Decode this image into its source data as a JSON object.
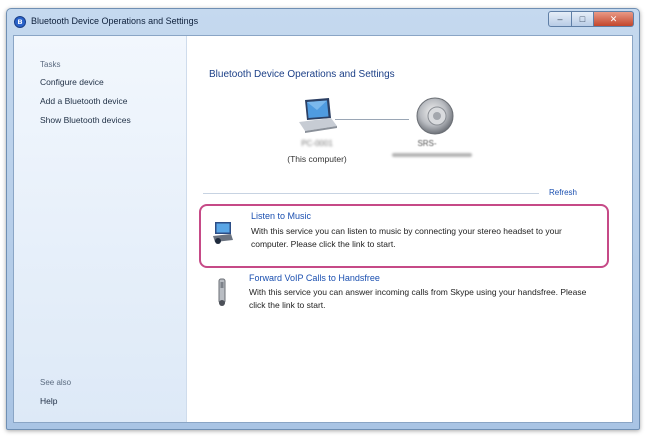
{
  "window": {
    "title": "Bluetooth Device Operations and Settings",
    "min_label": "–",
    "max_label": "□",
    "close_label": "✕"
  },
  "sidebar": {
    "tasks_heading": "Tasks",
    "tasks": [
      {
        "label": "Configure device"
      },
      {
        "label": "Add a Bluetooth device"
      },
      {
        "label": "Show Bluetooth devices"
      }
    ],
    "see_also_heading": "See also",
    "help_label": "Help"
  },
  "main": {
    "title": "Bluetooth Device Operations and Settings",
    "computer": {
      "name": "PC-0001",
      "subtitle": "(This computer)",
      "icon": "laptop-icon"
    },
    "device": {
      "name": "SRS-",
      "icon": "speaker-icon"
    },
    "refresh_label": "Refresh",
    "services": [
      {
        "title": "Listen to Music",
        "description": "With this service you can listen to music by connecting your stereo headset to your computer. Please click the link to start.",
        "icon": "music-service-icon"
      },
      {
        "title": "Forward VoIP Calls to Handsfree",
        "description": "With this service you can answer incoming calls from Skype using your handsfree. Please click the link to start.",
        "icon": "handsfree-icon"
      }
    ]
  },
  "colors": {
    "accent_link": "#1a4fb0",
    "highlight_border": "#c64a87",
    "sidebar_bg": "#e6eff9"
  }
}
